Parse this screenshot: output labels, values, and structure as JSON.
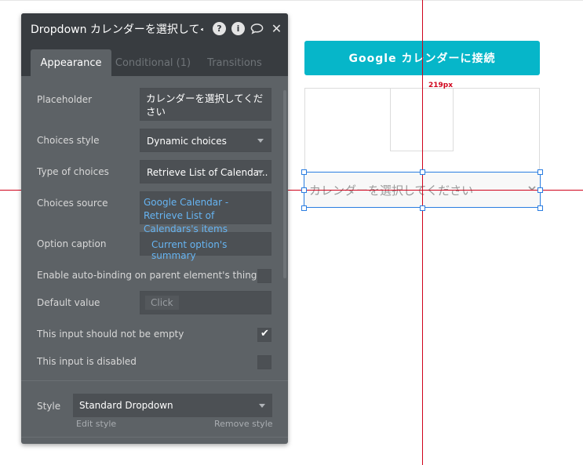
{
  "canvas": {
    "google_button_label": "Google カレンダーに接続",
    "measure_label": "219px",
    "dropdown_placeholder": "カレンダーを選択してください"
  },
  "panel": {
    "title": "Dropdown カレンダーを選択して<",
    "tabs": [
      "Appearance",
      "Conditional (1)",
      "Transitions"
    ],
    "placeholder_label": "Placeholder",
    "placeholder_value": "カレンダーを選択してください",
    "choices_style_label": "Choices style",
    "choices_style_value": "Dynamic choices",
    "type_of_choices_label": "Type of choices",
    "type_of_choices_value": "Retrieve List of Calenda...",
    "choices_source_label": "Choices source",
    "choices_source_value": "Google Calendar - Retrieve List of Calendars's items",
    "option_caption_label": "Option caption",
    "option_caption_value": "Current option's summary",
    "auto_binding_label": "Enable auto-binding on parent element's thing",
    "default_value_label": "Default value",
    "default_value_chip": "Click",
    "not_empty_label": "This input should not be empty",
    "not_empty_checked": true,
    "disabled_label": "This input is disabled",
    "disabled_checked": false,
    "style_label": "Style",
    "style_value": "Standard Dropdown",
    "edit_style_label": "Edit style",
    "remove_style_label": "Remove style"
  },
  "colors": {
    "accent": "#06b6c9",
    "guide": "#d0021b",
    "selection": "#2a7de1",
    "link": "#66b4f2",
    "panel_bg": "#5d6266",
    "panel_header": "#383c40"
  },
  "icons": {
    "help": "help-icon",
    "info": "info-icon",
    "comment": "comment-icon",
    "close": "close-icon"
  }
}
